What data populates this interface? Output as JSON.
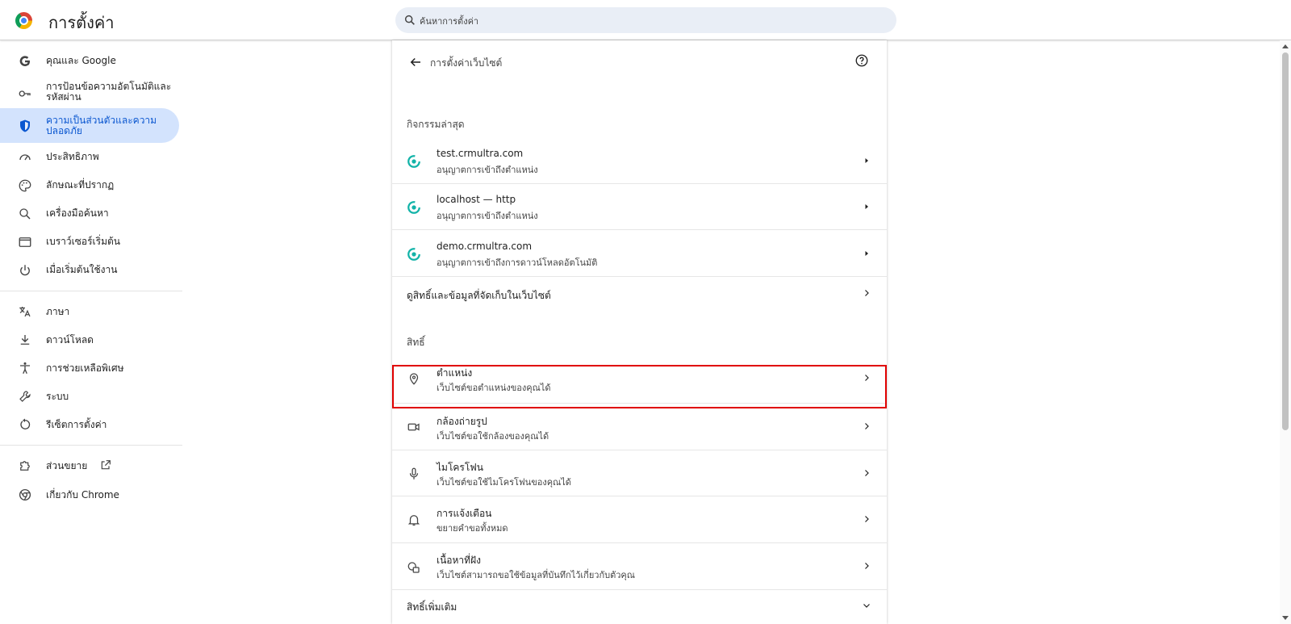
{
  "app": {
    "title": "การตั้งค่า"
  },
  "search": {
    "placeholder": "ค้นหาการตั้งค่า"
  },
  "sidebar": {
    "items": [
      {
        "label": "คุณและ Google",
        "icon": "google-g-icon"
      },
      {
        "label": "การป้อนข้อความอัตโนมัติและรหัสผ่าน",
        "line1": "การป้อนข้อความอัตโนมัติและ",
        "line2": "รหัสผ่าน",
        "icon": "key-icon"
      },
      {
        "label": "ความเป็นส่วนตัวและความปลอดภัย",
        "line1": "ความเป็นส่วนตัวและความ",
        "line2": "ปลอดภัย",
        "icon": "shield-icon",
        "active": true
      },
      {
        "label": "ประสิทธิภาพ",
        "icon": "speedometer-icon"
      },
      {
        "label": "ลักษณะที่ปรากฏ",
        "icon": "palette-icon"
      },
      {
        "label": "เครื่องมือค้นหา",
        "icon": "search-icon"
      },
      {
        "label": "เบราว์เซอร์เริ่มต้น",
        "icon": "browser-window-icon"
      },
      {
        "label": "เมื่อเริ่มต้นใช้งาน",
        "icon": "power-icon"
      },
      {
        "label": "ภาษา",
        "icon": "translate-icon"
      },
      {
        "label": "ดาวน์โหลด",
        "icon": "download-icon"
      },
      {
        "label": "การช่วยเหลือพิเศษ",
        "icon": "accessibility-icon"
      },
      {
        "label": "ระบบ",
        "icon": "wrench-icon"
      },
      {
        "label": "รีเซ็ตการตั้งค่า",
        "icon": "reset-icon"
      },
      {
        "label": "ส่วนขยาย",
        "icon": "extension-icon"
      },
      {
        "label": "เกี่ยวกับ Chrome",
        "icon": "chrome-icon"
      }
    ]
  },
  "main": {
    "title": "การตั้งค่าเว็บไซต์",
    "recent_heading": "กิจกรรมล่าสุด",
    "recent": [
      {
        "site": "test.crmultra.com",
        "detail": "อนุญาตการเข้าถึงตำแหน่ง"
      },
      {
        "site": "localhost  —  http",
        "detail": "อนุญาตการเข้าถึงตำแหน่ง"
      },
      {
        "site": "demo.crmultra.com",
        "detail": "อนุญาตการเข้าถึงการดาวน์โหลดอัตโนมัติ"
      }
    ],
    "view_permissions": "ดูสิทธิ์และข้อมูลที่จัดเก็บในเว็บไซต์",
    "permissions_heading": "สิทธิ์",
    "permissions": [
      {
        "title": "ตำแหน่ง",
        "subtitle": "เว็บไซต์ขอตำแหน่งของคุณได้",
        "icon": "location-pin-icon"
      },
      {
        "title": "กล้องถ่ายรูป",
        "subtitle": "เว็บไซต์ขอใช้กล้องของคุณได้",
        "icon": "camera-icon"
      },
      {
        "title": "ไมโครโฟน",
        "subtitle": "เว็บไซต์ขอใช้ไมโครโฟนของคุณได้",
        "icon": "microphone-icon"
      },
      {
        "title": "การแจ้งเตือน",
        "subtitle": "ขยายคำขอทั้งหมด",
        "icon": "bell-icon"
      },
      {
        "title": "เนื้อหาที่ฝัง",
        "subtitle": "เว็บไซต์สามารถขอใช้ข้อมูลที่บันทึกไว้เกี่ยวกับตัวคุณ",
        "icon": "embedded-content-icon"
      }
    ],
    "more_permissions": "สิทธิ์เพิ่มเติม"
  },
  "colors": {
    "accent": "#0b57d0",
    "active_bg": "#d3e3fd",
    "highlight": "#e00000",
    "site_icon": "#12b3a8"
  }
}
